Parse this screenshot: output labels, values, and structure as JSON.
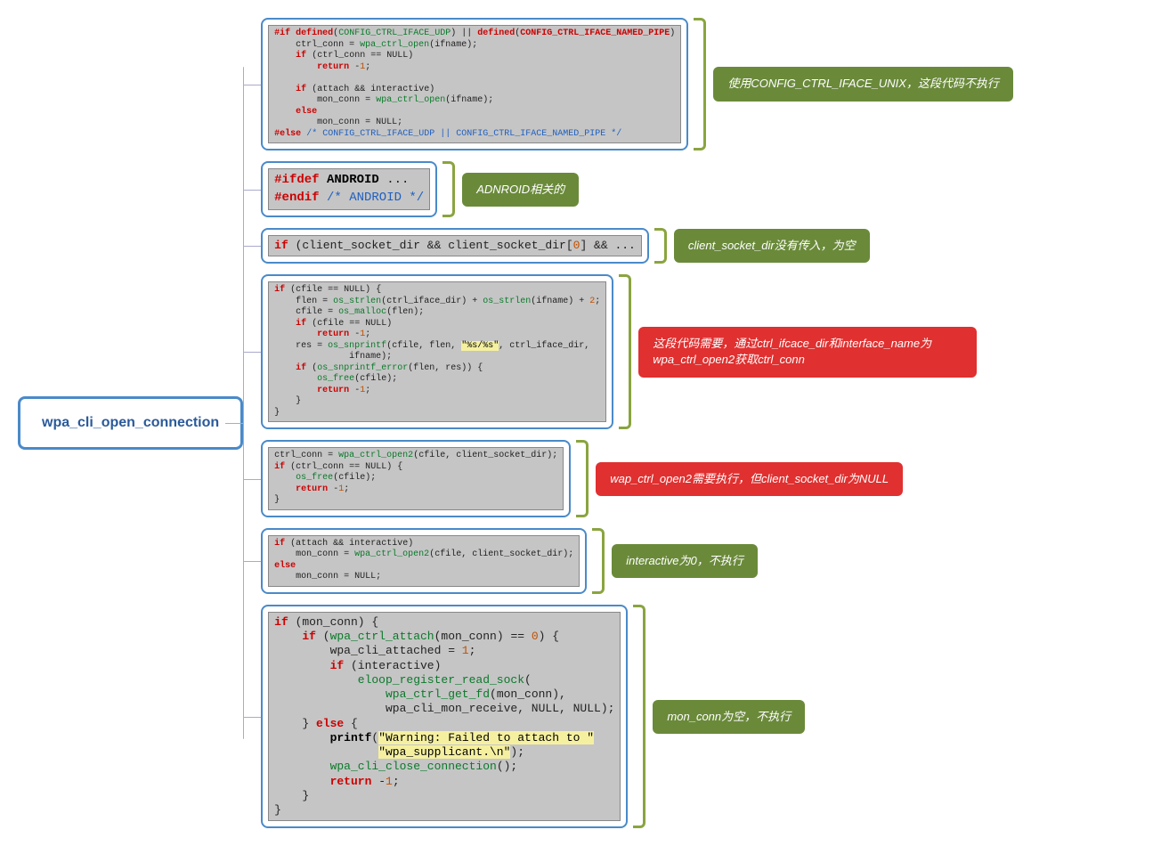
{
  "root": {
    "title": "wpa_cli_open_connection"
  },
  "blocks": [
    {
      "annot_class": "green",
      "annot": "使用CONFIG_CTRL_IFACE_UNIX，这段代码不执行"
    },
    {
      "annot_class": "green",
      "annot": "ADNROID相关的"
    },
    {
      "annot_class": "green",
      "annot": "client_socket_dir没有传入，为空"
    },
    {
      "annot_class": "red",
      "annot": "这段代码需要，通过ctrl_ifcace_dir和interface_name为wpa_ctrl_open2获取ctrl_conn"
    },
    {
      "annot_class": "red",
      "annot": "wap_ctrl_open2需要执行，但client_socket_dir为NULL"
    },
    {
      "annot_class": "green",
      "annot": "interactive为0，不执行"
    },
    {
      "annot_class": "green",
      "annot": "mon_conn为空，不执行"
    }
  ]
}
